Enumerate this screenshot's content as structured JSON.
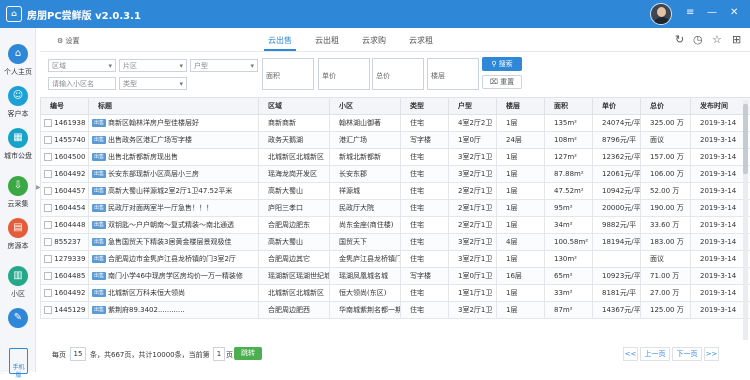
{
  "app": {
    "title": "房朋PC尝鲜版 v2.0.3.1"
  },
  "window_controls": {
    "menu": "≡",
    "minimize": "—",
    "close": "✕"
  },
  "sidebar": {
    "items": [
      {
        "label": "个人主页",
        "icon": "home-icon",
        "glyph": "⌂",
        "color": "#2f87d8"
      },
      {
        "label": "客户本",
        "icon": "customer-icon",
        "glyph": "☺",
        "color": "#1ca1d7"
      },
      {
        "label": "城市公盘",
        "icon": "city-icon",
        "glyph": "▦",
        "color": "#17a2c8"
      },
      {
        "label": "云采集",
        "icon": "cloud-download-icon",
        "glyph": "⇩",
        "color": "#3aa845"
      },
      {
        "label": "房源本",
        "icon": "house-book-icon",
        "glyph": "▤",
        "color": "#e45d3a"
      },
      {
        "label": "小区",
        "icon": "community-icon",
        "glyph": "▥",
        "color": "#24a88a"
      },
      {
        "label": "",
        "icon": "edit-icon",
        "glyph": "✎",
        "color": "#2f87d8"
      }
    ],
    "phone_label": "手机版"
  },
  "toolbar": {
    "settings_label": "设置"
  },
  "tabs": [
    {
      "label": "云出售",
      "active": true
    },
    {
      "label": "云出租",
      "active": false
    },
    {
      "label": "云求购",
      "active": false
    },
    {
      "label": "云求租",
      "active": false
    }
  ],
  "filters": {
    "district": "区域",
    "subdistrict": "片区",
    "usage": "户型",
    "community_placeholder": "请输入小区名",
    "type": "类型",
    "area_label": "面积",
    "price_label": "单价",
    "total_label": "总价",
    "floor_label": "楼层",
    "search_label": "搜索",
    "reset_label": "重置"
  },
  "table": {
    "columns": [
      "编号",
      "标题",
      "区域",
      "小区",
      "类型",
      "户型",
      "楼层",
      "面积",
      "单价",
      "总价",
      "发布时间"
    ],
    "tag": "出售",
    "rows": [
      [
        "1461938",
        "商新区翰林洋房户型佳楼层好",
        "商新商新",
        "翰林湖山御著",
        "住宅",
        "4室2厅2卫",
        "1层",
        "135m²",
        "24074元/平",
        "325.00 万",
        "2019-3-14"
      ],
      [
        "1455740",
        "出售政务区港汇广场写字楼",
        "政务天鹅湖",
        "港汇广场",
        "写字楼",
        "1室0厅",
        "24层",
        "108m²",
        "8796元/平",
        "面议",
        "2019-3-14"
      ],
      [
        "1604500",
        "出售北新都新房现出售",
        "北城新区北城新区",
        "新城北新都新",
        "住宅",
        "3室2厅1卫",
        "1层",
        "127m²",
        "12362元/平",
        "157.00 万",
        "2019-3-14"
      ],
      [
        "1604492",
        "长安东部现新小区高层小三房",
        "瑶海龙岗开发区",
        "长安东郡",
        "住宅",
        "3室2厅1卫",
        "1层",
        "87.88m²",
        "12061元/平",
        "106.00 万",
        "2019-3-14"
      ],
      [
        "1604457",
        "高新大蜀山祥源城2室2厅1卫47.52平米",
        "高新大蜀山",
        "祥源城",
        "住宅",
        "2室2厅1卫",
        "1层",
        "47.52m²",
        "10942元/平",
        "52.00 万",
        "2019-3-14"
      ],
      [
        "1604454",
        "民政厅对面两室半一厅急售！！！",
        "庐阳三孝口",
        "民政厅大院",
        "住宅",
        "2室1厅1卫",
        "1层",
        "95m²",
        "20000元/平",
        "190.00 万",
        "2019-3-14"
      ],
      [
        "1604448",
        "双钥匙～户户朝南～复式精装～南北通透",
        "合肥周边肥东",
        "尚东金座(商住楼)",
        "住宅",
        "2室2厅1卫",
        "1层",
        "34m²",
        "9882元/平",
        "33.60 万",
        "2019-3-14"
      ],
      [
        "855237",
        "急售国贸天下精装3居黄金楼层景观极佳",
        "高新大蜀山",
        "国贸天下",
        "住宅",
        "3室2厅1卫",
        "4层",
        "100.58m²",
        "18194元/平",
        "183.00 万",
        "2019-3-14"
      ],
      [
        "1279339",
        "合肥周边市金隽庐江县龙桥镇的门3室2厅",
        "合肥周边其它",
        "金隽庐江县龙桥镇门",
        "住宅",
        "3室2厅1卫",
        "1层",
        "130m²",
        "",
        "面议",
        "2019-3-14"
      ],
      [
        "1604485",
        "南门小学46中现房学区房均价一万一精装修",
        "瑶湖新区瑶湖世纪城",
        "瑶湖凤凰城名城",
        "写字楼",
        "1室0厅1卫",
        "16层",
        "65m²",
        "10923元/平",
        "71.00 万",
        "2019-3-14"
      ],
      [
        "1604492",
        "北城新区万科未恒大领尚",
        "北城新区北城新区",
        "恒大领尚(东区)",
        "住宅",
        "1室1厅1卫",
        "1层",
        "33m²",
        "8181元/平",
        "27.00 万",
        "2019-3-14"
      ],
      [
        "1445129",
        "紫荆府89.3402............",
        "合肥周边肥西",
        "华南城紫荆名都一期",
        "住宅",
        "3室2厅1卫",
        "1层",
        "87m²",
        "14367元/平",
        "125.00 万",
        "2019-3-14"
      ]
    ]
  },
  "pager": {
    "prefix": "每页",
    "page_size": "15",
    "summary": "条，共667页，共计10000条，当前第",
    "page": "1",
    "suffix": "页",
    "go_label": "跳转",
    "first": "<<",
    "prev": "上一页",
    "next": "下一页",
    "last": ">>"
  }
}
